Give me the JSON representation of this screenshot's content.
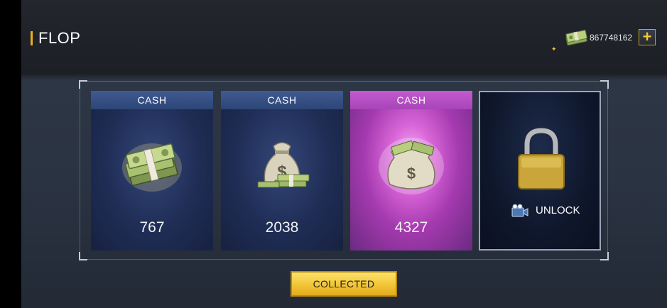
{
  "header": {
    "title": "FLOP"
  },
  "currency": {
    "amount": "867748162",
    "add_label": "+"
  },
  "cards": [
    {
      "label": "CASH",
      "value": "767",
      "reward": "cash-stack"
    },
    {
      "label": "CASH",
      "value": "2038",
      "reward": "cash-sack-small"
    },
    {
      "label": "CASH",
      "value": "4327",
      "reward": "cash-sack-large"
    }
  ],
  "locked_card": {
    "label": "UNLOCK",
    "icon": "video-film-icon"
  },
  "actions": {
    "collect_label": "COLLECTED"
  },
  "colors": {
    "accent": "#e8b020",
    "highlight": "#c45ad0",
    "card_blue": "#2d4677"
  }
}
